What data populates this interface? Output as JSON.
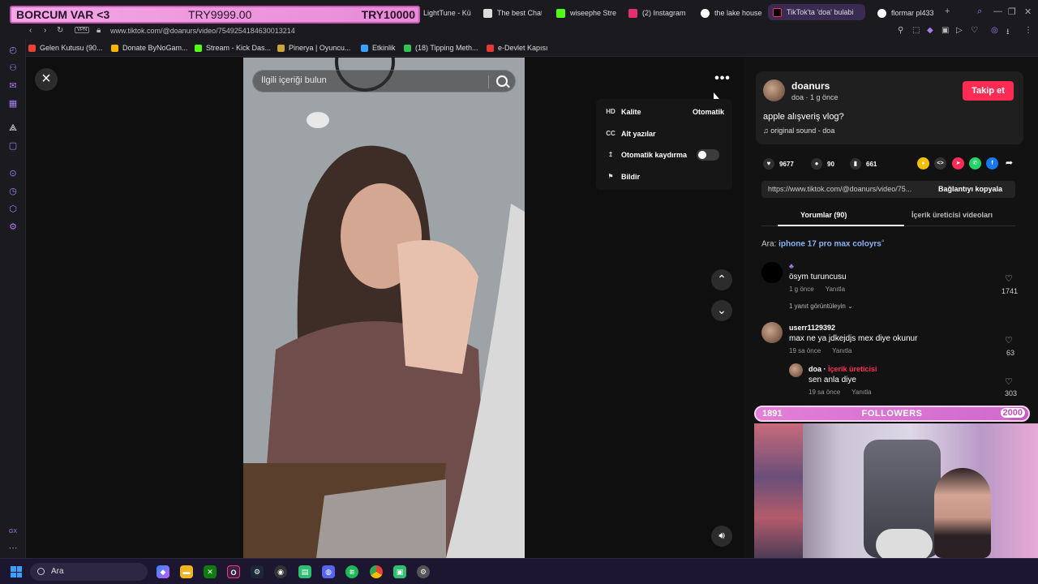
{
  "overlay": {
    "donation_left": "BORCUM VAR <3",
    "donation_mid": "TRY9999.00",
    "donation_right": "TRY10000",
    "followers_current": "1891",
    "followers_label": "FOLLOWERS",
    "followers_goal": "2000",
    "followers_progress": 0.9455
  },
  "tabs": [
    {
      "label": "LightTune - Kü",
      "color": "#888"
    },
    {
      "label": "The best Chat",
      "color": "#ddd"
    },
    {
      "label": "wiseephe Stre",
      "color": "#53fc18"
    },
    {
      "label": "(2) Instagram",
      "color": "#e1306c"
    },
    {
      "label": "the lake house",
      "color": "#ffffff"
    },
    {
      "label": "TikTok'ta 'doa' bulabi",
      "color": "#fe2c55"
    },
    {
      "label": "flormar pl433",
      "color": "#ffffff"
    }
  ],
  "address": {
    "vpn": "VPN",
    "url": "www.tiktok.com/@doanurs/video/7549254184630013214"
  },
  "bookmarks": [
    {
      "label": "Gelen Kutusu (90...",
      "color": "#ea4335"
    },
    {
      "label": "Donate ByNoGam...",
      "color": "#f4b400"
    },
    {
      "label": "Stream - Kick Das...",
      "color": "#53fc18"
    },
    {
      "label": "Pinerya | Oyuncu...",
      "color": "#c9a43a"
    },
    {
      "label": "Etkinlik",
      "color": "#3aa0ff"
    },
    {
      "label": "(18) Tipping Meth...",
      "color": "#35c15a"
    },
    {
      "label": "e-Devlet Kapısı",
      "color": "#e53935"
    }
  ],
  "video": {
    "search_placeholder": "İlgili içeriği bulun",
    "menu": [
      {
        "icon": "HD",
        "label": "Kalite",
        "value": "Otomatik"
      },
      {
        "icon": "CC",
        "label": "Alt yazılar",
        "value": ""
      },
      {
        "icon": "↥",
        "label": "Otomatik kaydırma",
        "value": ""
      },
      {
        "icon": "⚑",
        "label": "Bildir",
        "value": ""
      }
    ]
  },
  "post": {
    "username": "doanurs",
    "subline": "doa · 1 g önce",
    "follow_label": "Takip et",
    "description": "apple alışveriş vlog?",
    "sound": "original sound - doa",
    "likes": "9677",
    "comments": "90",
    "saves": "661",
    "link": "https://www.tiktok.com/@doanurs/video/75...",
    "copy_label": "Bağlantıyı kopyala",
    "tab_comments": "Yorumlar (90)",
    "tab_creator": "İçerik üreticisi videoları",
    "related_prefix": "Ara:",
    "related_query": "iphone 17 pro max coloyrs"
  },
  "comments": [
    {
      "user": "",
      "text": "ösym turuncusu",
      "time": "1 g önce",
      "reply": "Yanıtla",
      "likes": "1741",
      "more": "1 yanıt görüntüleyin"
    },
    {
      "user": "userr1129392",
      "text": "max ne ya jdkejdjs mex diye okunur",
      "time": "19 sa önce",
      "reply": "Yanıtla",
      "likes": "63"
    },
    {
      "user": "doa",
      "badge": "İçerik üreticisi",
      "text": "sen anla diye",
      "time": "19 sa önce",
      "reply": "Yanıtla",
      "likes": "303"
    }
  ],
  "taskbar": {
    "search_label": "Ara"
  }
}
